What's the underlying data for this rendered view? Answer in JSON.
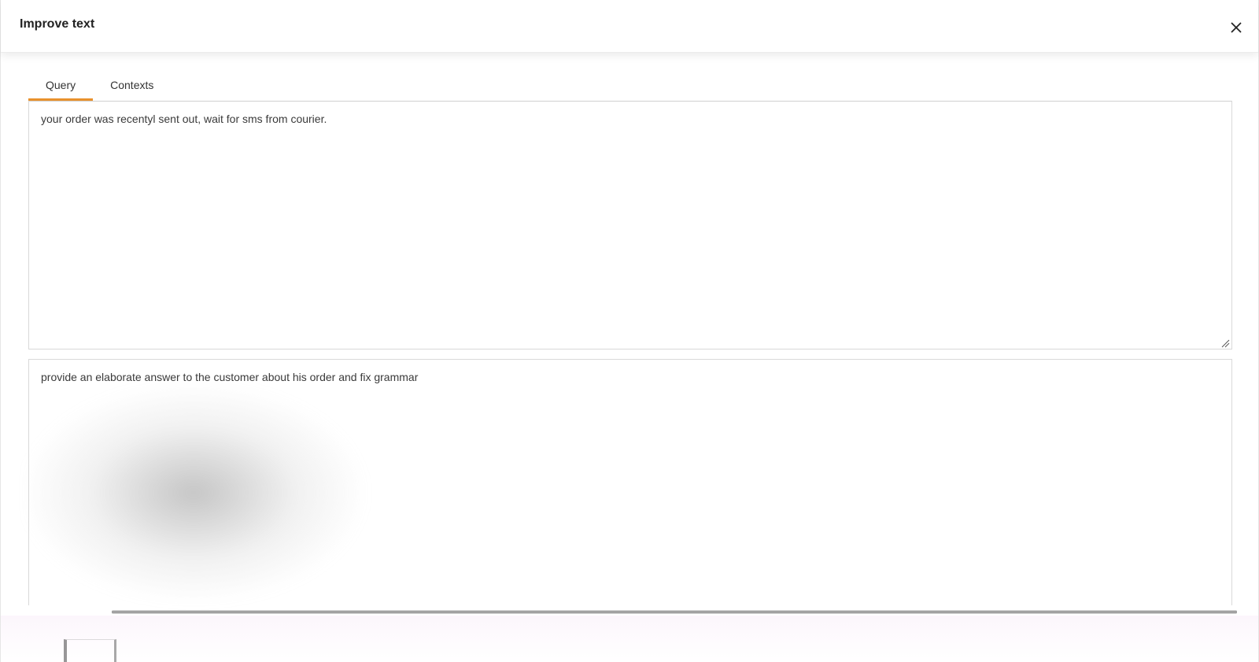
{
  "dialog": {
    "title": "Improve text",
    "close_icon": "close-icon"
  },
  "tabs": [
    {
      "label": "Query",
      "active": true
    },
    {
      "label": "Contexts",
      "active": false
    }
  ],
  "query": {
    "value": "your order was recentyl sent out, wait for sms from courier."
  },
  "instruction": {
    "value": "provide an elaborate answer to the customer about his order and fix grammar"
  },
  "colors": {
    "accent": "#e8912d",
    "border": "#d9d9d9"
  }
}
